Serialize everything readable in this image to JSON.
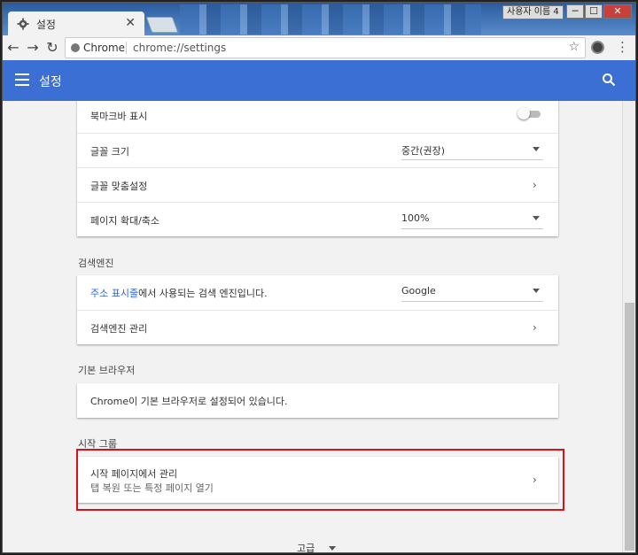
{
  "window": {
    "tab_title": "설정",
    "profile_label": "사용자 이름 4",
    "controls": {
      "minimize": "─",
      "maximize": "☐",
      "close": "✕"
    }
  },
  "toolbar": {
    "chip_label": "Chrome",
    "url": "chrome://settings"
  },
  "header": {
    "title": "설정"
  },
  "appearance": {
    "rows": [
      {
        "label": "북마크바 표시"
      },
      {
        "label": "글꼴 크기",
        "value": "중간(권장)"
      },
      {
        "label": "글꼴 맞춤설정"
      },
      {
        "label": "페이지 확대/축소",
        "value": "100%"
      }
    ]
  },
  "search_engine": {
    "title": "검색엔진",
    "row1_link": "주소 표시줄",
    "row1_rest": "에서 사용되는 검색 엔진입니다.",
    "row1_value": "Google",
    "row2_label": "검색엔진 관리"
  },
  "default_browser": {
    "title": "기본 브라우저",
    "message": "Chrome이 기본 브라우저로 설정되어 있습니다."
  },
  "startup": {
    "title": "시작 그룹",
    "label": "시작 페이지에서 관리",
    "sub": "탭 복원 또는 특정 페이지 열기"
  },
  "advanced_label": "고급"
}
